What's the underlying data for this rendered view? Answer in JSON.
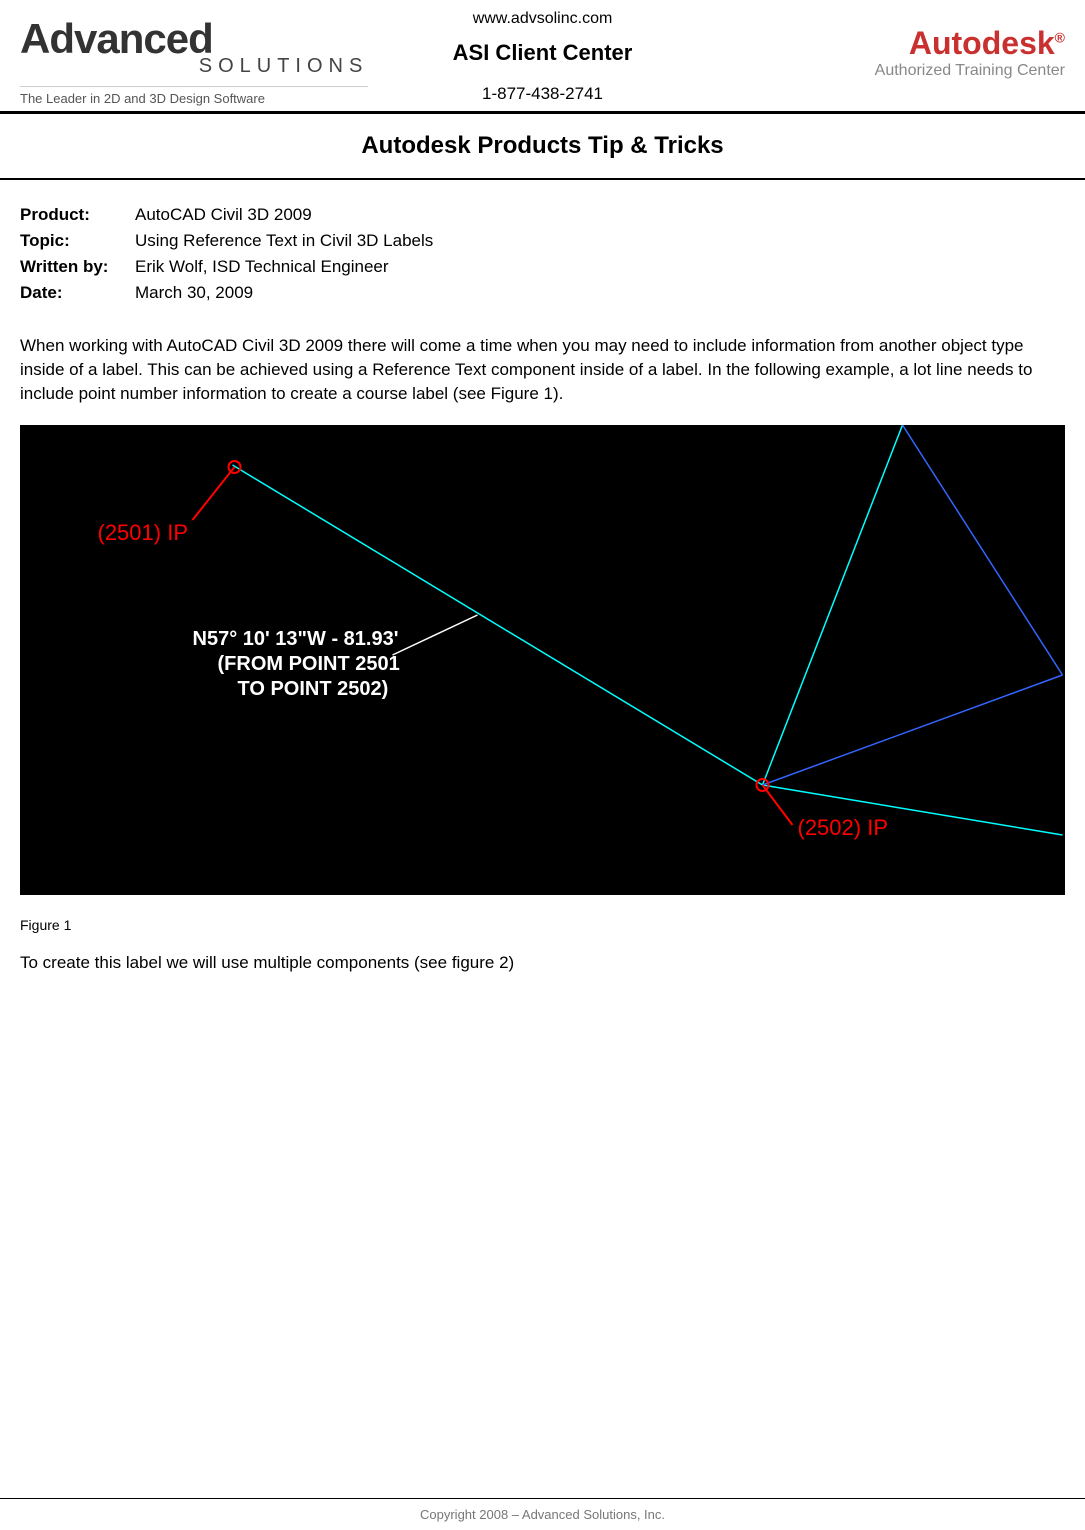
{
  "header": {
    "left_logo": {
      "main": "Advanced",
      "sub": "SOLUTIONS",
      "tagline": "The Leader in 2D and 3D Design Software"
    },
    "center": {
      "url": "www.advsolinc.com",
      "title": "ASI Client Center",
      "phone": "1-877-438-2741"
    },
    "right_logo": {
      "brand": "Autodesk",
      "reg": "®",
      "sub": "Authorized Training Center"
    }
  },
  "page_title": "Autodesk Products Tip & Tricks",
  "meta": {
    "product_label": "Product:",
    "product_value": "AutoCAD Civil 3D 2009",
    "topic_label": "Topic:",
    "topic_value": "Using Reference Text in Civil 3D Labels",
    "author_label": "Written by:",
    "author_value": "Erik Wolf, ISD Technical Engineer",
    "date_label": "Date:",
    "date_value": "March 30, 2009"
  },
  "paragraphs": {
    "p1": "When working with AutoCAD Civil 3D 2009 there will come a time when you may need to include information from another object type inside of a label.  This can be achieved using a Reference Text component inside of a label. In the following example, a lot line needs to include point number information to create a course label (see Figure 1).",
    "p2": "To create this label we will use multiple components (see figure 2)"
  },
  "figure1": {
    "caption": "Figure 1",
    "point1_label": "(2501)  IP",
    "bearing_line1": "N57° 10' 13\"W - 81.93'",
    "bearing_line2": "(FROM POINT 2501",
    "bearing_line3": "TO POINT 2502)",
    "point2_label": "(2502)  IP"
  },
  "footer": "Copyright 2008 – Advanced Solutions, Inc."
}
